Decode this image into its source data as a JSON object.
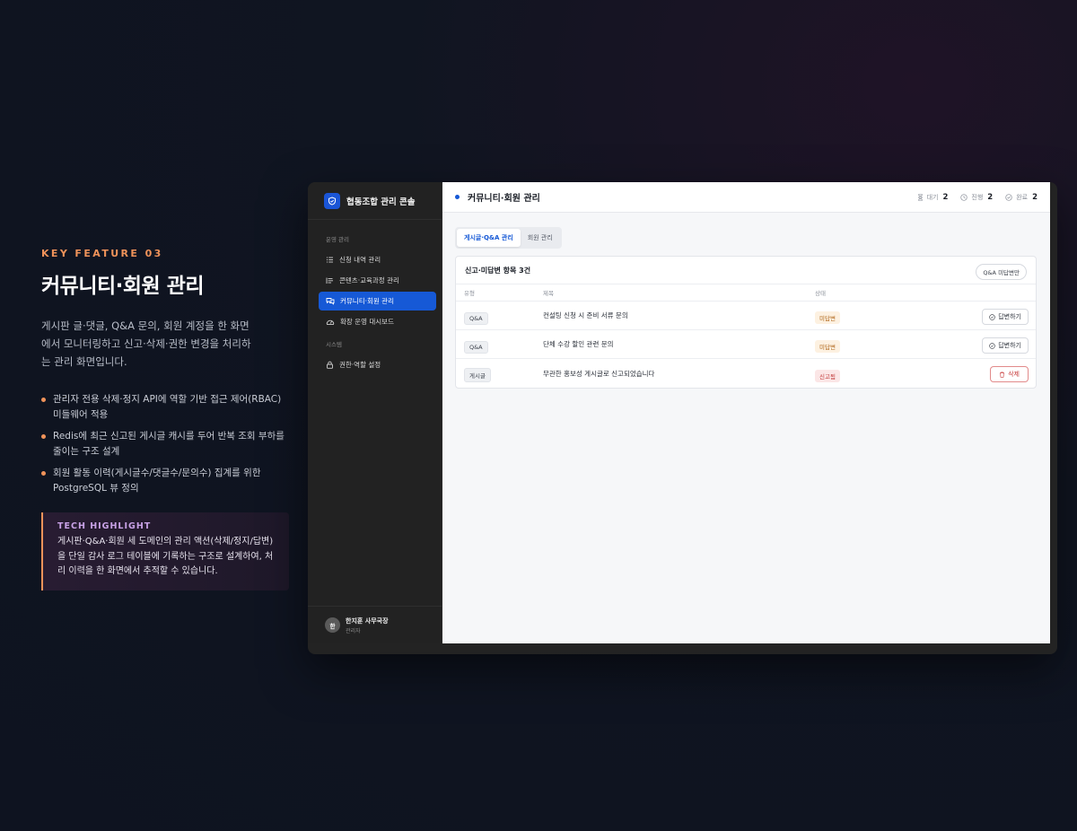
{
  "intro": {
    "kicker": "KEY FEATURE 03",
    "headline": "커뮤니티·회원 관리",
    "description": "게시판 글·댓글, Q&A 문의, 회원 계정을 한 화면에서 모니터링하고 신고·삭제·권한 변경을 처리하는 관리 화면입니다.",
    "features": [
      "관리자 전용 삭제·정지 API에 역할 기반 접근 제어(RBAC) 미들웨어 적용",
      "Redis에 최근 신고된 게시글 캐시를 두어 반복 조회 부하를 줄이는 구조 설계",
      "회원 활동 이력(게시글수/댓글수/문의수) 집계를 위한 PostgreSQL 뷰 정의"
    ],
    "tech_title": "TECH HIGHLIGHT",
    "tech_body": "게시판·Q&A·회원 세 도메인의 관리 액션(삭제/정지/답변)을 단일 감사 로그 테이블에 기록하는 구조로 설계하여, 처리 이력을 한 화면에서 추적할 수 있습니다."
  },
  "app": {
    "brand": "협동조합 관리 콘솔",
    "nav_section_ops": "운영 관리",
    "nav_section_sys": "시스템",
    "nav": [
      {
        "label": "신청 내역 관리",
        "icon": "list-icon"
      },
      {
        "label": "콘텐츠·교육과정 관리",
        "icon": "content-list-icon"
      },
      {
        "label": "커뮤니티·회원 관리",
        "icon": "chat-icon"
      },
      {
        "label": "확장 운영 대시보드",
        "icon": "gauge-icon"
      },
      {
        "label": "권한·역할 설정",
        "icon": "lock-icon"
      }
    ],
    "user": {
      "initial": "한",
      "name": "한지훈 사무국장",
      "role": "관리자"
    },
    "page_title": "커뮤니티·회원 관리",
    "stats": [
      {
        "label": "대기",
        "value": "2",
        "icon": "hourglass-icon"
      },
      {
        "label": "진행",
        "value": "2",
        "icon": "clock-icon"
      },
      {
        "label": "완료",
        "value": "2",
        "icon": "check-circle-icon"
      }
    ],
    "tabs": [
      "게시글·Q&A 관리",
      "회원 관리"
    ],
    "card": {
      "title": "신고·미답변 항목 3건",
      "filter_label": "Q&A 미답변만",
      "columns": [
        "유형",
        "제목",
        "상태"
      ],
      "rows": [
        {
          "type": "Q&A",
          "title": "컨설팅 신청 시 준비 서류 문의",
          "status": "미답변",
          "action": "답변하기"
        },
        {
          "type": "Q&A",
          "title": "단체 수강 할인 관련 문의",
          "status": "미답변",
          "action": "답변하기"
        },
        {
          "type": "게시글",
          "title": "무관한 홍보성 게시글로 신고되었습니다",
          "status": "신고됨",
          "action": "삭제"
        }
      ]
    }
  },
  "colors": {
    "accent_orange": "#f0935a",
    "brand_blue": "#1659d6",
    "pending": "#b0661a",
    "reported": "#c33d3d"
  }
}
